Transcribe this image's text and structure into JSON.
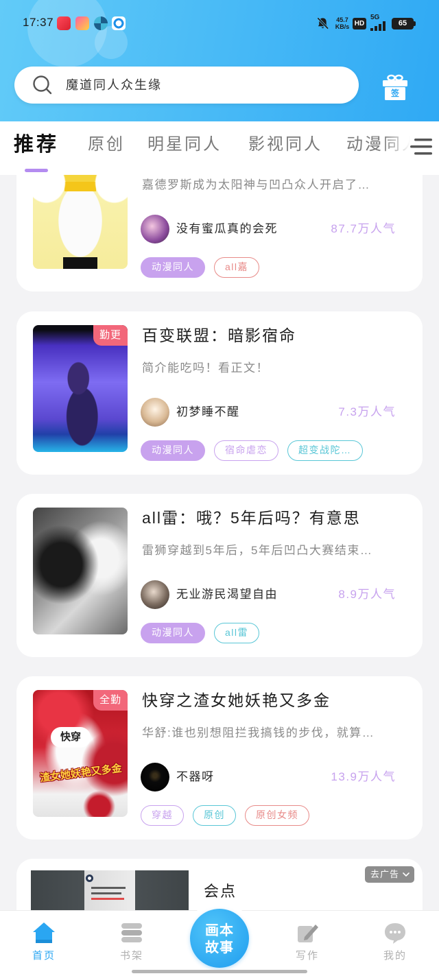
{
  "status_bar": {
    "time": "17:37",
    "net_speed_value": "45.7",
    "net_speed_unit": "KB/s",
    "hd": "HD",
    "network": "5G",
    "battery": "65"
  },
  "search": {
    "hint": "魔道同人众生缘",
    "icon": "search-icon"
  },
  "signin": {
    "label": "签",
    "icon": "gift-icon"
  },
  "tabs": [
    {
      "label": "推荐",
      "active": true
    },
    {
      "label": "原创"
    },
    {
      "label": "明星同人"
    },
    {
      "label": "影视同人"
    },
    {
      "label": "动漫同人"
    }
  ],
  "feed": {
    "cards": [
      {
        "description": "嘉德罗斯成为太阳神与凹凸众人开启了…",
        "author": "没有蜜瓜真的会死",
        "popularity": "87.7万人气",
        "tags": [
          "动漫同人",
          "all嘉"
        ]
      },
      {
        "badge": "勤更",
        "title": "百变联盟：暗影宿命",
        "description": "简介能吃吗！看正文！",
        "author": "初梦睡不醒",
        "popularity": "7.3万人气",
        "tags": [
          "动漫同人",
          "宿命虐恋",
          "超变战陀…"
        ]
      },
      {
        "title": "all雷：哦？5年后吗？有意思",
        "description": "雷狮穿越到5年后，5年后凹凸大赛结束…",
        "author": "无业游民渴望自由",
        "popularity": "8.9万人气",
        "tags": [
          "动漫同人",
          "all雷"
        ]
      },
      {
        "badge": "全勤",
        "title": "快穿之渣女她妖艳又多金",
        "description": "华舒:谁也别想阻拦我搞钱的步伐，就算…",
        "author": "不器呀",
        "popularity": "13.9万人气",
        "tags": [
          "穿越",
          "原创",
          "原创女频"
        ],
        "cover_text": [
          "快穿",
          "渣女她妖艳又多金"
        ]
      }
    ],
    "ad": {
      "remove_ad_label": "去广告",
      "title": "会点"
    }
  },
  "bottom_nav": {
    "items": [
      {
        "label": "首页",
        "icon": "home-icon",
        "active": true
      },
      {
        "label": "书架",
        "icon": "bookshelf-icon"
      },
      {
        "label": "写作",
        "icon": "write-pen-icon"
      },
      {
        "label": "我的",
        "icon": "chat-bubble-icon"
      }
    ],
    "center_button": {
      "line1": "画本",
      "line2": "故事"
    }
  },
  "colors": {
    "header_start": "#62cbf8",
    "header_end": "#2fa9f4",
    "accent": "#2aa6f2",
    "tab_indicator": "#b48cf0",
    "popularity": "#c7a2ee",
    "badge": "#f2677a",
    "tag_purple": "#c8a2ee",
    "tag_red": "#e88a88",
    "tag_teal": "#58c6d6"
  }
}
